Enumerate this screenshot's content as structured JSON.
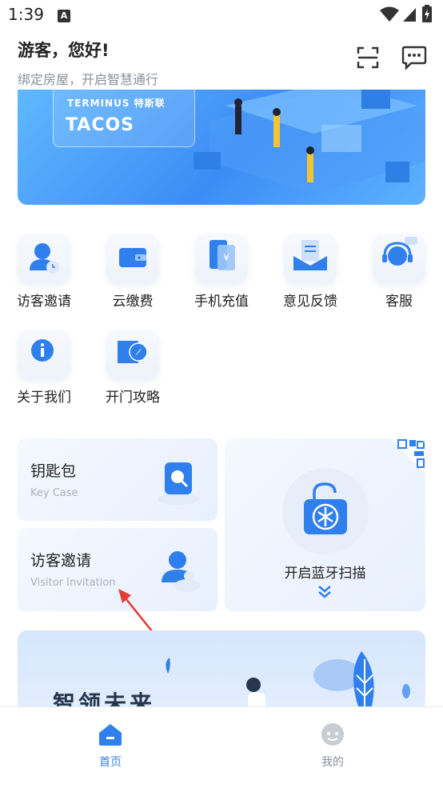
{
  "status": {
    "time": "1:39",
    "notif_letter": "A"
  },
  "header": {
    "greeting": "游客，您好!",
    "subtitle": "绑定房屋，开启智慧通行"
  },
  "banner": {
    "brand": "TERMINUS 特斯联",
    "product": "TACOS"
  },
  "grid": [
    {
      "label": "访客邀请"
    },
    {
      "label": "云缴费"
    },
    {
      "label": "手机充值"
    },
    {
      "label": "意见反馈"
    },
    {
      "label": "客服"
    },
    {
      "label": "关于我们"
    },
    {
      "label": "开门攻略"
    }
  ],
  "cards": {
    "key_case": {
      "title": "钥匙包",
      "subtitle": "Key Case"
    },
    "visitor": {
      "title": "访客邀请",
      "subtitle": "Visitor Invitation"
    },
    "bluetooth": {
      "title": "开启蓝牙扫描"
    }
  },
  "promo": {
    "title": "智领未来"
  },
  "nav": [
    {
      "label": "首页",
      "active": true
    },
    {
      "label": "我的",
      "active": false
    }
  ],
  "colors": {
    "accent": "#2f80ed",
    "nav_inactive": "#8a8f99"
  }
}
